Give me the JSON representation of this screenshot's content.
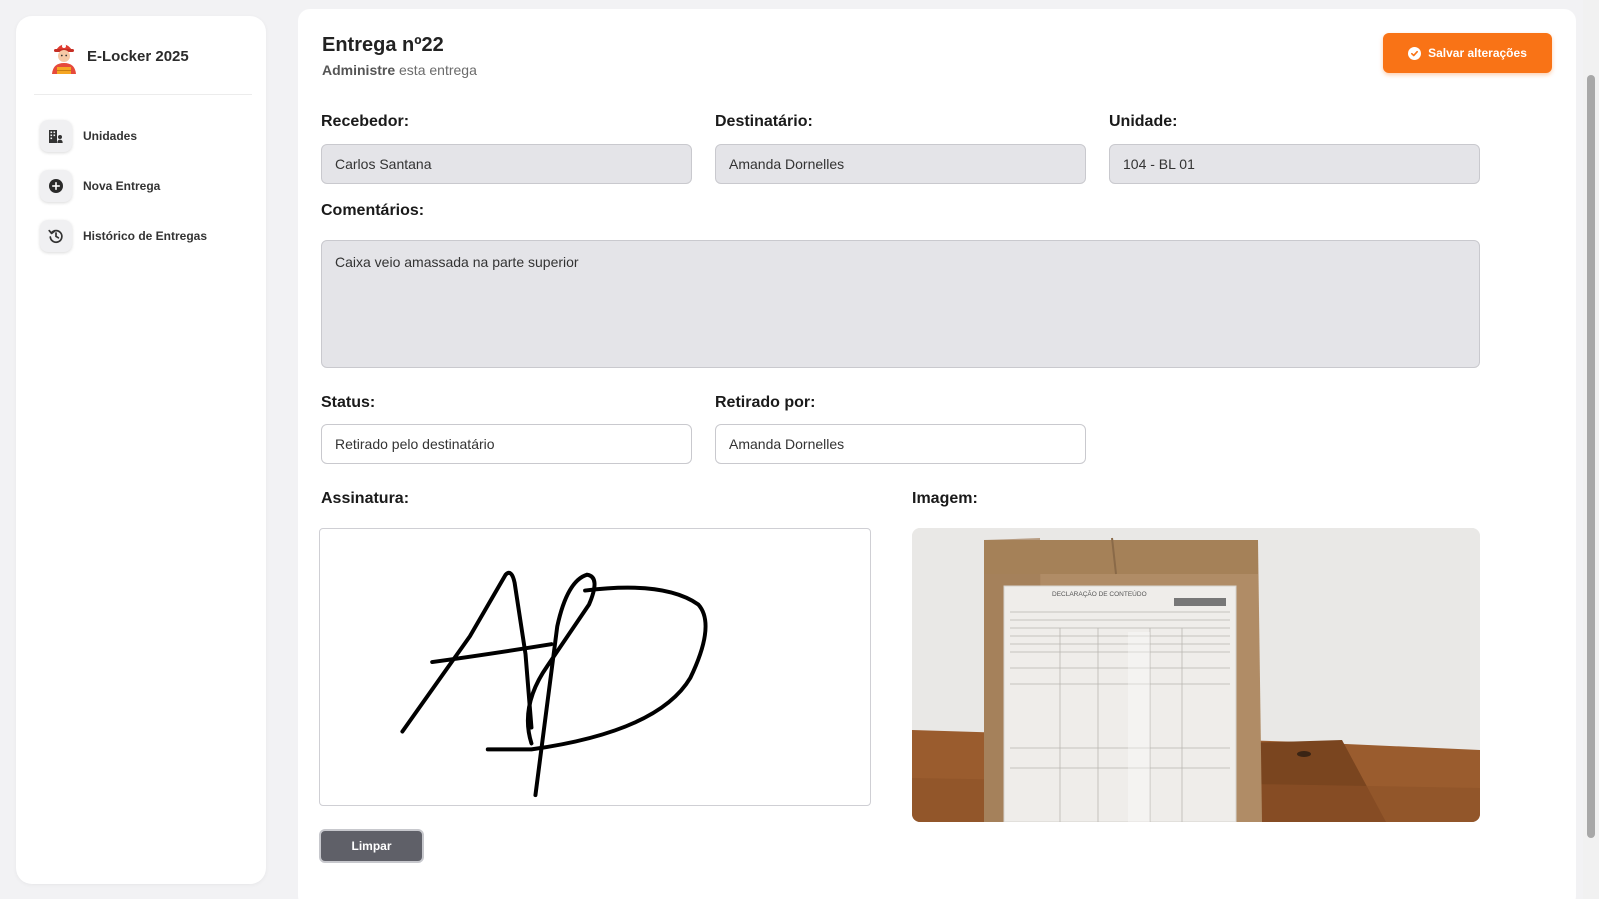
{
  "sidebar": {
    "brand": "E-Locker 2025",
    "items": [
      {
        "label": "Unidades",
        "icon": "building-user-icon"
      },
      {
        "label": "Nova Entrega",
        "icon": "plus-circle-icon"
      },
      {
        "label": "Histórico de Entregas",
        "icon": "history-icon"
      }
    ]
  },
  "header": {
    "title": "Entrega nº22",
    "subtitle_strong": "Administre",
    "subtitle_rest": " esta entrega",
    "save_label": "Salvar alterações"
  },
  "form": {
    "recebedor": {
      "label": "Recebedor:",
      "value": "Carlos Santana"
    },
    "destinatario": {
      "label": "Destinatário:",
      "value": "Amanda Dornelles"
    },
    "unidade": {
      "label": "Unidade:",
      "value": "104 - BL 01"
    },
    "comentarios": {
      "label": "Comentários:",
      "value": "Caixa veio amassada na parte superior"
    },
    "status": {
      "label": "Status:",
      "value": "Retirado pelo destinatário"
    },
    "retirado_por": {
      "label": "Retirado por:",
      "value": "Amanda Dornelles"
    },
    "assinatura": {
      "label": "Assinatura:",
      "clear_label": "Limpar"
    },
    "imagem": {
      "label": "Imagem:",
      "doc_title": "DECLARAÇÃO DE CONTEÚDO"
    }
  },
  "colors": {
    "accent": "#f97316",
    "field_bg": "#e4e4e8",
    "clear_button": "#5f6068"
  }
}
